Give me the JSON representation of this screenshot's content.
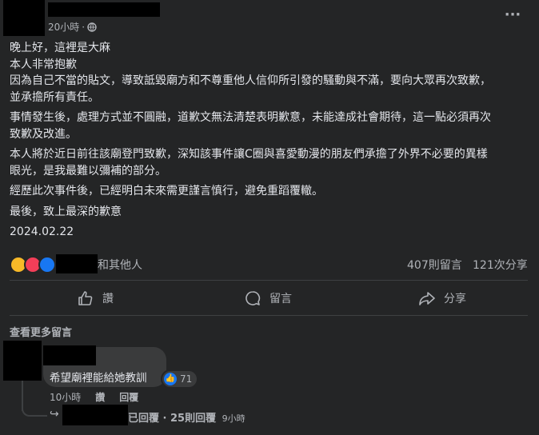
{
  "post": {
    "time": "20小時",
    "separator": "·",
    "more_label": "···",
    "paragraphs": [
      [
        "晚上好，這裡是大麻",
        "本人非常抱歉",
        "因為自己不當的貼文，導致詆毀廟方和不尊重他人信仰所引發的騷動與不滿，要向大眾再次致歉，",
        "並承擔所有責任。"
      ],
      [
        "事情發生後，處理方式並不圓融，道歉文無法清楚表明歉意，未能達成社會期待，這一點必須再次",
        "致歉及改進。"
      ],
      [
        "本人將於近日前往該廟登門致歉，深知該事件讓C圈與喜愛動漫的朋友們承擔了外界不必要的異樣",
        "眼光，是我最難以彌補的部分。"
      ],
      [
        "經歷此次事件後，已經明白未來需更謹言慎行，避免重蹈覆轍。"
      ],
      [
        "最後，致上最深的歉意"
      ],
      [
        "2024.02.22"
      ]
    ]
  },
  "reactions": {
    "others_label": "和其他人",
    "comments_count": "407則留言",
    "shares_count": "121次分享"
  },
  "actions": {
    "like": "讚",
    "comment": "留言",
    "share": "分享"
  },
  "comments": {
    "view_more": "查看更多留言",
    "first": {
      "text": "希望廟裡能給她教訓",
      "like_count": "71",
      "time": "10小時",
      "like_action": "讚",
      "reply_action": "回覆",
      "replies_text": "已回覆 · 25則回覆",
      "replies_time": "9小時"
    }
  },
  "colors": {
    "background": "#242526",
    "text": "#e4e6eb",
    "muted": "#b0b3b8",
    "bubble": "#3a3b3c",
    "like_blue": "#1877f2"
  }
}
